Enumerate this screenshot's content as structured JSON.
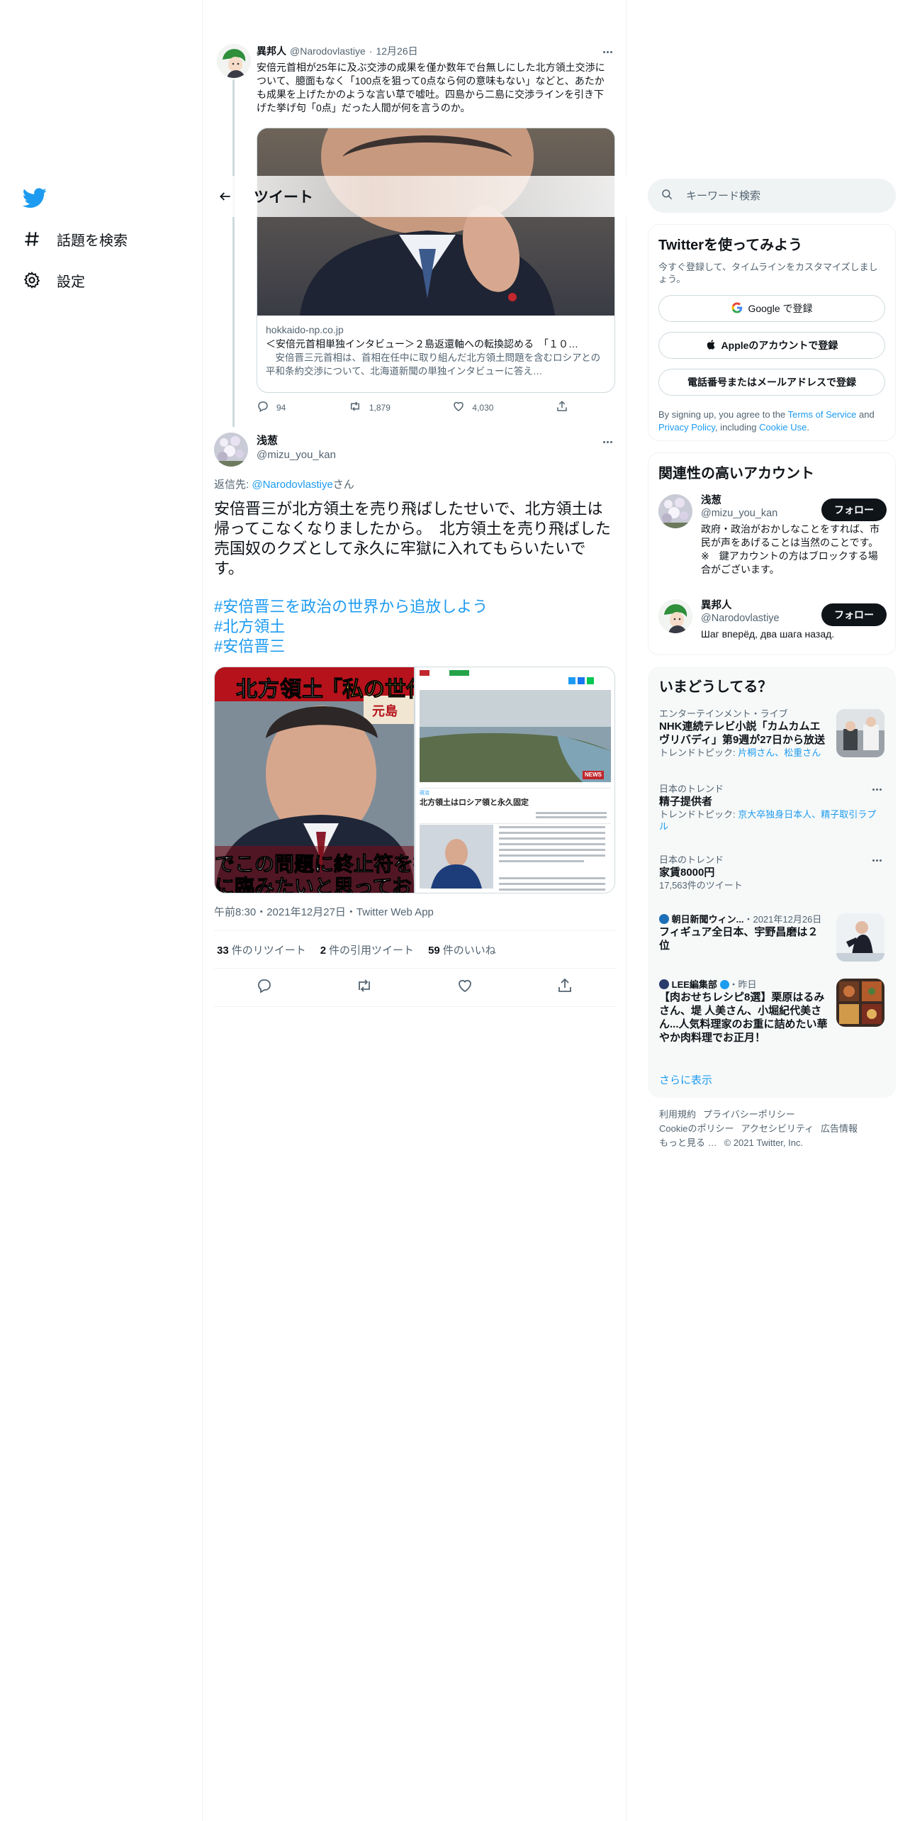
{
  "nav": {
    "items": [
      {
        "label": "話題を検索",
        "icon": "hashtag-icon"
      },
      {
        "label": "設定",
        "icon": "gear-icon"
      }
    ]
  },
  "header": {
    "title": "ツイート"
  },
  "parent_tweet": {
    "name": "異邦人",
    "handle": "@Narodovlastiye",
    "dot": "·",
    "date": "12月26日",
    "text": "安倍元首相が25年に及ぶ交渉の成果を僅か数年で台無しにした北方領土交渉について、臆面もなく「100点を狙って0点なら何の意味もない」などと、あたかも成果を上げたかのような言い草で嘘吐。四島から二島に交渉ラインを引き下げた挙げ句「0点」だった人間が何を言うのか。",
    "card": {
      "domain": "hokkaido-np.co.jp",
      "title": "＜安倍元首相単独インタビュー＞２島返還軸への転換認める　「１０…",
      "description": "　安倍晋三元首相は、首相在任中に取り組んだ北方領土問題を含むロシアとの平和条約交渉について、北海道新聞の単独インタビューに答え…"
    },
    "actions": {
      "replies": "94",
      "retweets": "1,879",
      "likes": "4,030"
    }
  },
  "main_tweet": {
    "name": "浅葱",
    "handle": "@mizu_you_kan",
    "reply_prefix": "返信先: ",
    "reply_to": "@Narodovlastiye",
    "reply_suffix": "さん",
    "text": "安倍晋三が北方領土を売り飛ばしたせいで、北方領土は帰ってこなくなりましたから。　北方領土を売り飛ばした売国奴のクズとして永久に牢獄に入れてもらいたいです。",
    "hashtags": [
      "#安倍晋三を政治の世界から追放しよう",
      "#北方領土",
      "#安倍晋三"
    ],
    "media": {
      "left_caption_top": "北方領土",
      "left_caption_top2": "「私の世代",
      "left_caption_top3": "元島",
      "left_caption_bottom1": "でこの問題に終止符を打",
      "left_caption_bottom2": "に臨みたいと思っておりま",
      "right_badge": "NEWS",
      "right_headline": "北方領土はロシア領と永久固定",
      "right_section": "政治"
    },
    "timestamp": "午前8:30・2021年12月27日・Twitter Web App",
    "stats": [
      {
        "n": "33",
        "label": "件のリツイート"
      },
      {
        "n": "2",
        "label": "件の引用ツイート"
      },
      {
        "n": "59",
        "label": "件のいいね"
      }
    ]
  },
  "sidebar": {
    "search_placeholder": "キーワード検索",
    "signup": {
      "title": "Twitterを使ってみよう",
      "subtitle": "今すぐ登録して、タイムラインをカスタマイズしましょう。",
      "google": "Google で登録",
      "apple": "Appleのアカウントで登録",
      "phone": "電話番号またはメールアドレスで登録",
      "legal_1": "By signing up, you agree to the ",
      "tos": "Terms of Service",
      "legal_2": " and ",
      "privacy": "Privacy Policy",
      "legal_3": ", including ",
      "cookie": "Cookie Use",
      "legal_4": "."
    },
    "related": {
      "title": "関連性の高いアカウント",
      "follow": "フォロー",
      "accounts": [
        {
          "name": "浅葱",
          "handle": "@mizu_you_kan",
          "bio": "政府・政治がおかしなことをすれば、市民が声をあげることは当然のことです。　※　鍵アカウントの方はブロックする場合がございます。"
        },
        {
          "name": "異邦人",
          "handle": "@Narodovlastiye",
          "bio": "Шаг вперёд, два шага назад."
        }
      ]
    },
    "trends": {
      "title": "いまどうしてる？",
      "items": [
        {
          "meta": "エンターテインメント・ライブ",
          "name": "NHK連続テレビ小説「カムカムエヴリバディ」第9週が27日から放送",
          "topic_prefix": "トレンドトピック: ",
          "topic": "片桐さん、松重さん"
        },
        {
          "meta": "日本のトレンド",
          "name": "精子提供者",
          "topic_prefix": "トレンドトピック: ",
          "topic": "京大卒独身日本人、精子取引ラプル"
        },
        {
          "meta": "日本のトレンド",
          "name": "家賃8000円",
          "count": "17,563件のツイート"
        },
        {
          "source": "朝日新聞ウィン...",
          "date": "・2021年12月26日",
          "name": "フィギュア全日本、宇野昌磨は２位"
        },
        {
          "source": "LEE編集部",
          "date": "・昨日",
          "name": "【肉おせちレシピ8選】栗原はるみさん、堤 人美さん、小堀紀代美さん...人気料理家のお重に詰めたい華やか肉料理でお正月！"
        }
      ],
      "show_more": "さらに表示"
    },
    "footer": [
      "利用規約",
      "プライバシーポリシー",
      "Cookieのポリシー",
      "アクセシビリティ",
      "広告情報",
      "もっと見る …",
      "© 2021 Twitter, Inc."
    ]
  },
  "colors": {
    "accent": "#1d9bf0",
    "text": "#0f1419",
    "muted": "#536471",
    "border": "#eff3f4"
  }
}
